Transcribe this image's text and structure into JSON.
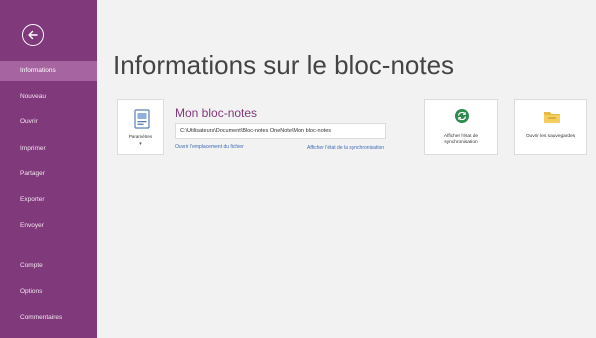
{
  "sidebar": {
    "items": [
      {
        "label": "Informations"
      },
      {
        "label": "Nouveau"
      },
      {
        "label": "Ouvrir"
      },
      {
        "label": "Imprimer"
      },
      {
        "label": "Partager"
      },
      {
        "label": "Exporter"
      },
      {
        "label": "Envoyer"
      },
      {
        "label": "Compte"
      },
      {
        "label": "Options"
      },
      {
        "label": "Commentaires"
      }
    ]
  },
  "main": {
    "title": "Informations sur le bloc-notes",
    "notebook": {
      "name": "Mon bloc-notes",
      "path": "C:\\Utilisateurs\\Document\\Bloc-notes OneNote\\Mon bloc-notes",
      "settings_label": "Paramètres",
      "link_open_location": "Ouvrir l'emplacement du fichier",
      "link_view_sync": "Afficher l'état de la synchronisation"
    },
    "tiles": [
      {
        "label": "Afficher l'état de synchronisation",
        "icon": "sync-status-icon"
      },
      {
        "label": "Ouvrir les sauvegardes",
        "icon": "backup-folder-icon"
      }
    ]
  },
  "colors": {
    "sidebar_bg": "#80397b",
    "sidebar_active": "#a664a0",
    "accent": "#80397b",
    "link": "#3f6bb5"
  }
}
